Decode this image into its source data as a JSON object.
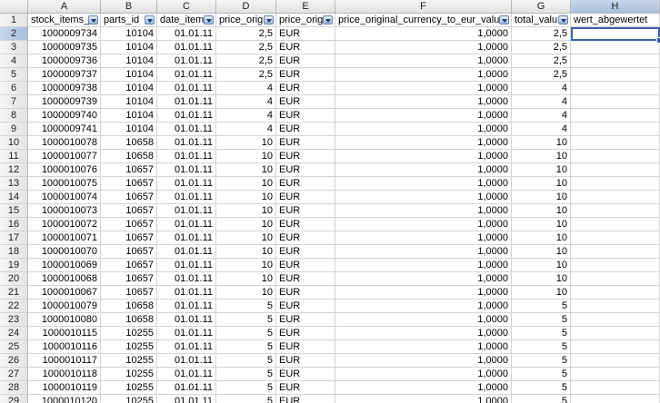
{
  "columns": [
    {
      "letter": "A",
      "header": "stock_items_",
      "filter": true
    },
    {
      "letter": "B",
      "header": "parts_id",
      "filter": true
    },
    {
      "letter": "C",
      "header": "date_item",
      "filter": true
    },
    {
      "letter": "D",
      "header": "price_orig",
      "filter": true
    },
    {
      "letter": "E",
      "header": "price_orig",
      "filter": true
    },
    {
      "letter": "F",
      "header": "price_original_currency_to_eur_valu",
      "filter": true
    },
    {
      "letter": "G",
      "header": "total_valu",
      "filter": true
    },
    {
      "letter": "H",
      "header": "wert_abgewertet",
      "filter": false
    }
  ],
  "header_row_number": "1",
  "selected_cell": "H2",
  "rows": [
    {
      "n": "2",
      "a": "1000009734",
      "b": "10104",
      "c": "01.01.11",
      "d": "2,5",
      "e": "EUR",
      "f": "1,0000",
      "g": "2,5",
      "h": ""
    },
    {
      "n": "3",
      "a": "1000009735",
      "b": "10104",
      "c": "01.01.11",
      "d": "2,5",
      "e": "EUR",
      "f": "1,0000",
      "g": "2,5",
      "h": ""
    },
    {
      "n": "4",
      "a": "1000009736",
      "b": "10104",
      "c": "01.01.11",
      "d": "2,5",
      "e": "EUR",
      "f": "1,0000",
      "g": "2,5",
      "h": ""
    },
    {
      "n": "5",
      "a": "1000009737",
      "b": "10104",
      "c": "01.01.11",
      "d": "2,5",
      "e": "EUR",
      "f": "1,0000",
      "g": "2,5",
      "h": ""
    },
    {
      "n": "6",
      "a": "1000009738",
      "b": "10104",
      "c": "01.01.11",
      "d": "4",
      "e": "EUR",
      "f": "1,0000",
      "g": "4",
      "h": ""
    },
    {
      "n": "7",
      "a": "1000009739",
      "b": "10104",
      "c": "01.01.11",
      "d": "4",
      "e": "EUR",
      "f": "1,0000",
      "g": "4",
      "h": ""
    },
    {
      "n": "8",
      "a": "1000009740",
      "b": "10104",
      "c": "01.01.11",
      "d": "4",
      "e": "EUR",
      "f": "1,0000",
      "g": "4",
      "h": ""
    },
    {
      "n": "9",
      "a": "1000009741",
      "b": "10104",
      "c": "01.01.11",
      "d": "4",
      "e": "EUR",
      "f": "1,0000",
      "g": "4",
      "h": ""
    },
    {
      "n": "10",
      "a": "1000010078",
      "b": "10658",
      "c": "01.01.11",
      "d": "10",
      "e": "EUR",
      "f": "1,0000",
      "g": "10",
      "h": ""
    },
    {
      "n": "11",
      "a": "1000010077",
      "b": "10658",
      "c": "01.01.11",
      "d": "10",
      "e": "EUR",
      "f": "1,0000",
      "g": "10",
      "h": ""
    },
    {
      "n": "12",
      "a": "1000010076",
      "b": "10657",
      "c": "01.01.11",
      "d": "10",
      "e": "EUR",
      "f": "1,0000",
      "g": "10",
      "h": ""
    },
    {
      "n": "13",
      "a": "1000010075",
      "b": "10657",
      "c": "01.01.11",
      "d": "10",
      "e": "EUR",
      "f": "1,0000",
      "g": "10",
      "h": ""
    },
    {
      "n": "14",
      "a": "1000010074",
      "b": "10657",
      "c": "01.01.11",
      "d": "10",
      "e": "EUR",
      "f": "1,0000",
      "g": "10",
      "h": ""
    },
    {
      "n": "15",
      "a": "1000010073",
      "b": "10657",
      "c": "01.01.11",
      "d": "10",
      "e": "EUR",
      "f": "1,0000",
      "g": "10",
      "h": ""
    },
    {
      "n": "16",
      "a": "1000010072",
      "b": "10657",
      "c": "01.01.11",
      "d": "10",
      "e": "EUR",
      "f": "1,0000",
      "g": "10",
      "h": ""
    },
    {
      "n": "17",
      "a": "1000010071",
      "b": "10657",
      "c": "01.01.11",
      "d": "10",
      "e": "EUR",
      "f": "1,0000",
      "g": "10",
      "h": ""
    },
    {
      "n": "18",
      "a": "1000010070",
      "b": "10657",
      "c": "01.01.11",
      "d": "10",
      "e": "EUR",
      "f": "1,0000",
      "g": "10",
      "h": ""
    },
    {
      "n": "19",
      "a": "1000010069",
      "b": "10657",
      "c": "01.01.11",
      "d": "10",
      "e": "EUR",
      "f": "1,0000",
      "g": "10",
      "h": ""
    },
    {
      "n": "20",
      "a": "1000010068",
      "b": "10657",
      "c": "01.01.11",
      "d": "10",
      "e": "EUR",
      "f": "1,0000",
      "g": "10",
      "h": ""
    },
    {
      "n": "21",
      "a": "1000010067",
      "b": "10657",
      "c": "01.01.11",
      "d": "10",
      "e": "EUR",
      "f": "1,0000",
      "g": "10",
      "h": ""
    },
    {
      "n": "22",
      "a": "1000010079",
      "b": "10658",
      "c": "01.01.11",
      "d": "5",
      "e": "EUR",
      "f": "1,0000",
      "g": "5",
      "h": ""
    },
    {
      "n": "23",
      "a": "1000010080",
      "b": "10658",
      "c": "01.01.11",
      "d": "5",
      "e": "EUR",
      "f": "1,0000",
      "g": "5",
      "h": ""
    },
    {
      "n": "24",
      "a": "1000010115",
      "b": "10255",
      "c": "01.01.11",
      "d": "5",
      "e": "EUR",
      "f": "1,0000",
      "g": "5",
      "h": ""
    },
    {
      "n": "25",
      "a": "1000010116",
      "b": "10255",
      "c": "01.01.11",
      "d": "5",
      "e": "EUR",
      "f": "1,0000",
      "g": "5",
      "h": ""
    },
    {
      "n": "26",
      "a": "1000010117",
      "b": "10255",
      "c": "01.01.11",
      "d": "5",
      "e": "EUR",
      "f": "1,0000",
      "g": "5",
      "h": ""
    },
    {
      "n": "27",
      "a": "1000010118",
      "b": "10255",
      "c": "01.01.11",
      "d": "5",
      "e": "EUR",
      "f": "1,0000",
      "g": "5",
      "h": ""
    },
    {
      "n": "28",
      "a": "1000010119",
      "b": "10255",
      "c": "01.01.11",
      "d": "5",
      "e": "EUR",
      "f": "1,0000",
      "g": "5",
      "h": ""
    },
    {
      "n": "29",
      "a": "1000010120",
      "b": "10255",
      "c": "01.01.11",
      "d": "5",
      "e": "EUR",
      "f": "1,0000",
      "g": "5",
      "h": ""
    }
  ]
}
